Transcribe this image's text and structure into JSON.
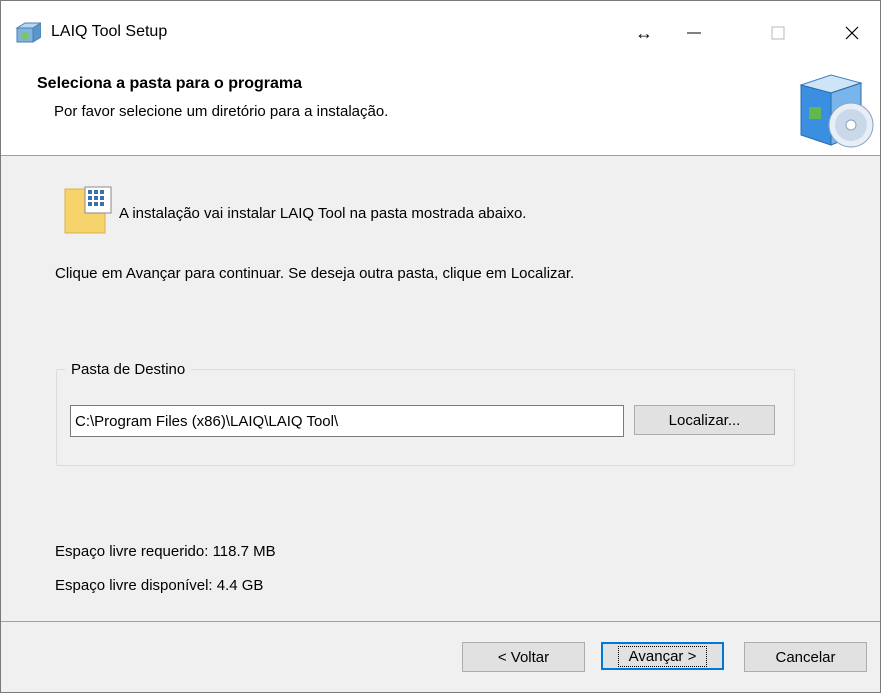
{
  "window": {
    "title": "LAIQ Tool Setup",
    "controls": {
      "resize": "↔",
      "minimize": "—",
      "maximize": "☐",
      "close": "✕"
    }
  },
  "header": {
    "title": "Seleciona a pasta para o programa",
    "subtitle": "Por favor selecione um diretório para a instalação."
  },
  "body": {
    "info_text": "A instalação vai instalar LAIQ Tool na pasta mostrada abaixo.",
    "instruction_text": "Clique em Avançar para continuar. Se deseja outra pasta, clique em Localizar.",
    "destination_group_label": "Pasta de Destino",
    "destination_path": "C:\\Program Files (x86)\\LAIQ\\LAIQ Tool\\",
    "browse_button": "Localizar...",
    "space_required": "Espaço livre requerido: 118.7 MB",
    "space_available": "Espaço livre disponível: 4.4 GB"
  },
  "footer": {
    "back_button": "< Voltar",
    "next_button": "Avançar >",
    "cancel_button": "Cancelar"
  },
  "colors": {
    "focus_border": "#0078d7",
    "folder": "#f7d46b"
  },
  "icons": {
    "app": "installer-box-icon",
    "header": "installer-disc-box-icon",
    "info": "folder-icon"
  }
}
